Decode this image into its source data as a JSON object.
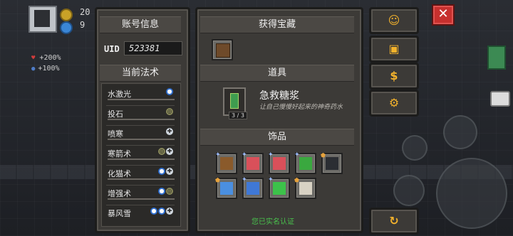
{
  "hud": {
    "coins": "20",
    "gems": "9",
    "stat_hp": "+200%",
    "stat_mp": "+100%"
  },
  "account": {
    "title": "账号信息",
    "uid_label": "UID",
    "uid_value": "523381",
    "spells_title": "当前法术",
    "spells": [
      {
        "name": "水激光",
        "icons": [
          "water"
        ]
      },
      {
        "name": "投石",
        "icons": [
          "earth"
        ]
      },
      {
        "name": "喷寒",
        "icons": [
          "air"
        ]
      },
      {
        "name": "寒箭术",
        "icons": [
          "earth",
          "air"
        ]
      },
      {
        "name": "化猫术",
        "icons": [
          "water",
          "air"
        ]
      },
      {
        "name": "增强术",
        "icons": [
          "water",
          "earth"
        ]
      },
      {
        "name": "暴风雪",
        "icons": [
          "water",
          "water",
          "air"
        ]
      }
    ]
  },
  "treasure": {
    "title": "获得宝藏",
    "items_title": "道具",
    "item_name": "急救糖浆",
    "item_desc": "让自己慢慢好起来的神奇药水",
    "item_count": "3 / 3",
    "accessories_title": "饰品",
    "accessories": [
      {
        "icon": "brown-scroll-icon",
        "badge": "star",
        "color": "#8a5a2b"
      },
      {
        "icon": "red-seed-icon",
        "badge": "star",
        "color": "#d9505a"
      },
      {
        "icon": "red-seed-icon",
        "badge": "star",
        "color": "#d9505a"
      },
      {
        "icon": "green-rune-icon",
        "badge": "star",
        "color": "#3aa83f"
      },
      {
        "icon": "dark-mask-icon",
        "badge": "shield",
        "color": "#2b2e33"
      },
      {
        "icon": "blue-claw-icon",
        "badge": "shield",
        "color": "#4a8fe0"
      },
      {
        "icon": "blue-staff-icon",
        "badge": "star",
        "color": "#3f78d6"
      },
      {
        "icon": "green-bug-icon",
        "badge": "star",
        "color": "#3cc24a"
      },
      {
        "icon": "white-bone-icon",
        "badge": "shield",
        "color": "#d8d2c4"
      }
    ],
    "verify_text": "您已实名认证"
  },
  "side_buttons": [
    {
      "name": "support-button",
      "glyph": "☺"
    },
    {
      "name": "gift-button",
      "glyph": "🎁"
    },
    {
      "name": "redeem-button",
      "glyph": "$"
    },
    {
      "name": "settings-button",
      "glyph": "⚙"
    },
    {
      "name": "refresh-button",
      "glyph": "↻"
    }
  ]
}
